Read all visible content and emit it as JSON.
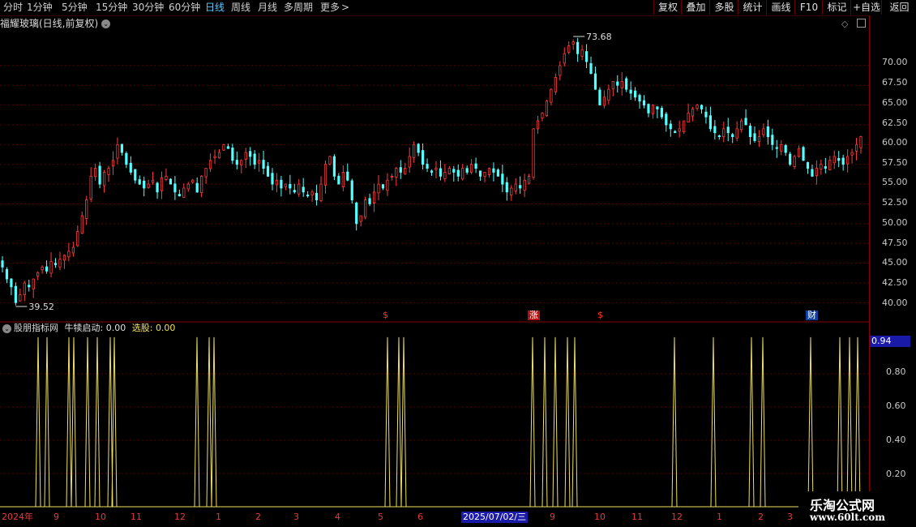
{
  "toolbar": {
    "periods": [
      "分时",
      "1分钟",
      "5分钟",
      "15分钟",
      "30分钟",
      "60分钟",
      "日线",
      "周线",
      "月线",
      "多周期",
      "更多"
    ],
    "active_period": "日线",
    "more_arrow": ">",
    "buttons": [
      "复权",
      "叠加",
      "多股",
      "统计",
      "画线",
      "F10",
      "标记",
      "+自选",
      "返回"
    ]
  },
  "chart_title": "福耀玻璃(日线,前复权)",
  "price_axis": [
    "70.00",
    "67.50",
    "65.00",
    "62.50",
    "60.00",
    "57.50",
    "55.00",
    "52.50",
    "50.00",
    "47.50",
    "45.00",
    "42.50",
    "40.00"
  ],
  "annotations": {
    "high": "73.68",
    "low": "39.52"
  },
  "markers": [
    {
      "text": "$",
      "color": "#ff3030",
      "bg": ""
    },
    {
      "text": "涨",
      "color": "#ffffff",
      "bg": "#b01010"
    },
    {
      "text": "$",
      "color": "#ff3030",
      "bg": ""
    },
    {
      "text": "财",
      "color": "#ffffff",
      "bg": "#1040a0"
    }
  ],
  "indicator": {
    "name": "股朋指标网",
    "label1": "牛犊启动:",
    "value1": "0.00",
    "label2": "选股:",
    "value2": "0.00",
    "axis": [
      "0.80",
      "0.60",
      "0.40",
      "0.20"
    ],
    "current": "0.94",
    "line_color": "#f0e060"
  },
  "date_axis": [
    {
      "label": "2024年"
    },
    {
      "label": "9"
    },
    {
      "label": "10"
    },
    {
      "label": "11"
    },
    {
      "label": "12"
    },
    {
      "label": "1"
    },
    {
      "label": "2"
    },
    {
      "label": "3"
    },
    {
      "label": "4"
    },
    {
      "label": "5"
    },
    {
      "label": "6"
    },
    {
      "label": "2025/07/02/三",
      "highlight": true
    },
    {
      "label": "9"
    },
    {
      "label": "10"
    },
    {
      "label": "11"
    },
    {
      "label": "12"
    },
    {
      "label": "1"
    },
    {
      "label": "2"
    },
    {
      "label": "3"
    }
  ],
  "watermark": {
    "line1": "乐淘公式网",
    "line2": "www.60lt.com"
  },
  "colors": {
    "up": "#ff3c3c",
    "down": "#54ffff",
    "grid": "#5a0000",
    "accent": "#5ec8ff"
  },
  "chart_data": {
    "type": "candlestick",
    "ylim": [
      39,
      75
    ],
    "close_path": [
      44.5,
      43,
      42,
      40,
      41,
      42.5,
      42,
      43,
      43.8,
      44.5,
      44,
      45.2,
      44.8,
      45.5,
      46,
      46.5,
      47,
      49,
      51,
      53,
      56,
      57,
      55,
      56.5,
      57,
      58,
      60,
      59,
      57.5,
      56.5,
      55.5,
      55,
      54.5,
      55,
      55.5,
      54,
      55.8,
      56,
      55,
      54,
      53.5,
      54.5,
      55,
      55.5,
      54,
      56,
      57,
      58,
      58.5,
      59,
      60,
      59.5,
      58,
      57.5,
      58,
      59,
      58.5,
      57.5,
      58,
      57,
      56,
      55,
      55.5,
      54.5,
      55,
      54.5,
      54,
      55,
      54,
      53.5,
      54,
      53,
      55,
      57.5,
      58.5,
      56,
      55,
      56.5,
      55.5,
      53,
      50,
      51,
      53,
      52.5,
      54,
      55,
      54.5,
      55.5,
      56,
      57,
      56.5,
      57,
      58.5,
      60,
      59,
      57.5,
      57,
      56.5,
      57,
      56,
      56.5,
      57,
      56.5,
      56,
      57,
      56.5,
      57.5,
      57,
      56,
      56.5,
      57,
      56.5,
      56,
      55,
      54,
      54.5,
      55,
      54.5,
      55.5,
      56,
      62,
      63,
      64,
      65.5,
      67,
      68.5,
      70,
      71.5,
      72.5,
      73,
      71.5,
      72,
      70.5,
      69,
      67,
      65,
      66,
      67,
      68,
      67.5,
      68,
      67,
      66.5,
      66,
      65.5,
      65,
      64,
      65,
      64.5,
      63.5,
      62.5,
      62,
      61.5,
      62,
      63,
      64,
      64.5,
      65,
      64.5,
      63.5,
      62,
      61.5,
      61,
      62,
      61.5,
      61,
      62,
      63,
      62.5,
      61,
      60.5,
      61,
      62,
      61,
      60,
      59.5,
      60,
      59,
      57.5,
      58.5,
      59.5,
      58,
      57,
      56,
      57,
      57.5,
      57,
      58,
      58.5,
      58,
      57.5,
      58.5,
      59,
      60,
      61
    ]
  }
}
